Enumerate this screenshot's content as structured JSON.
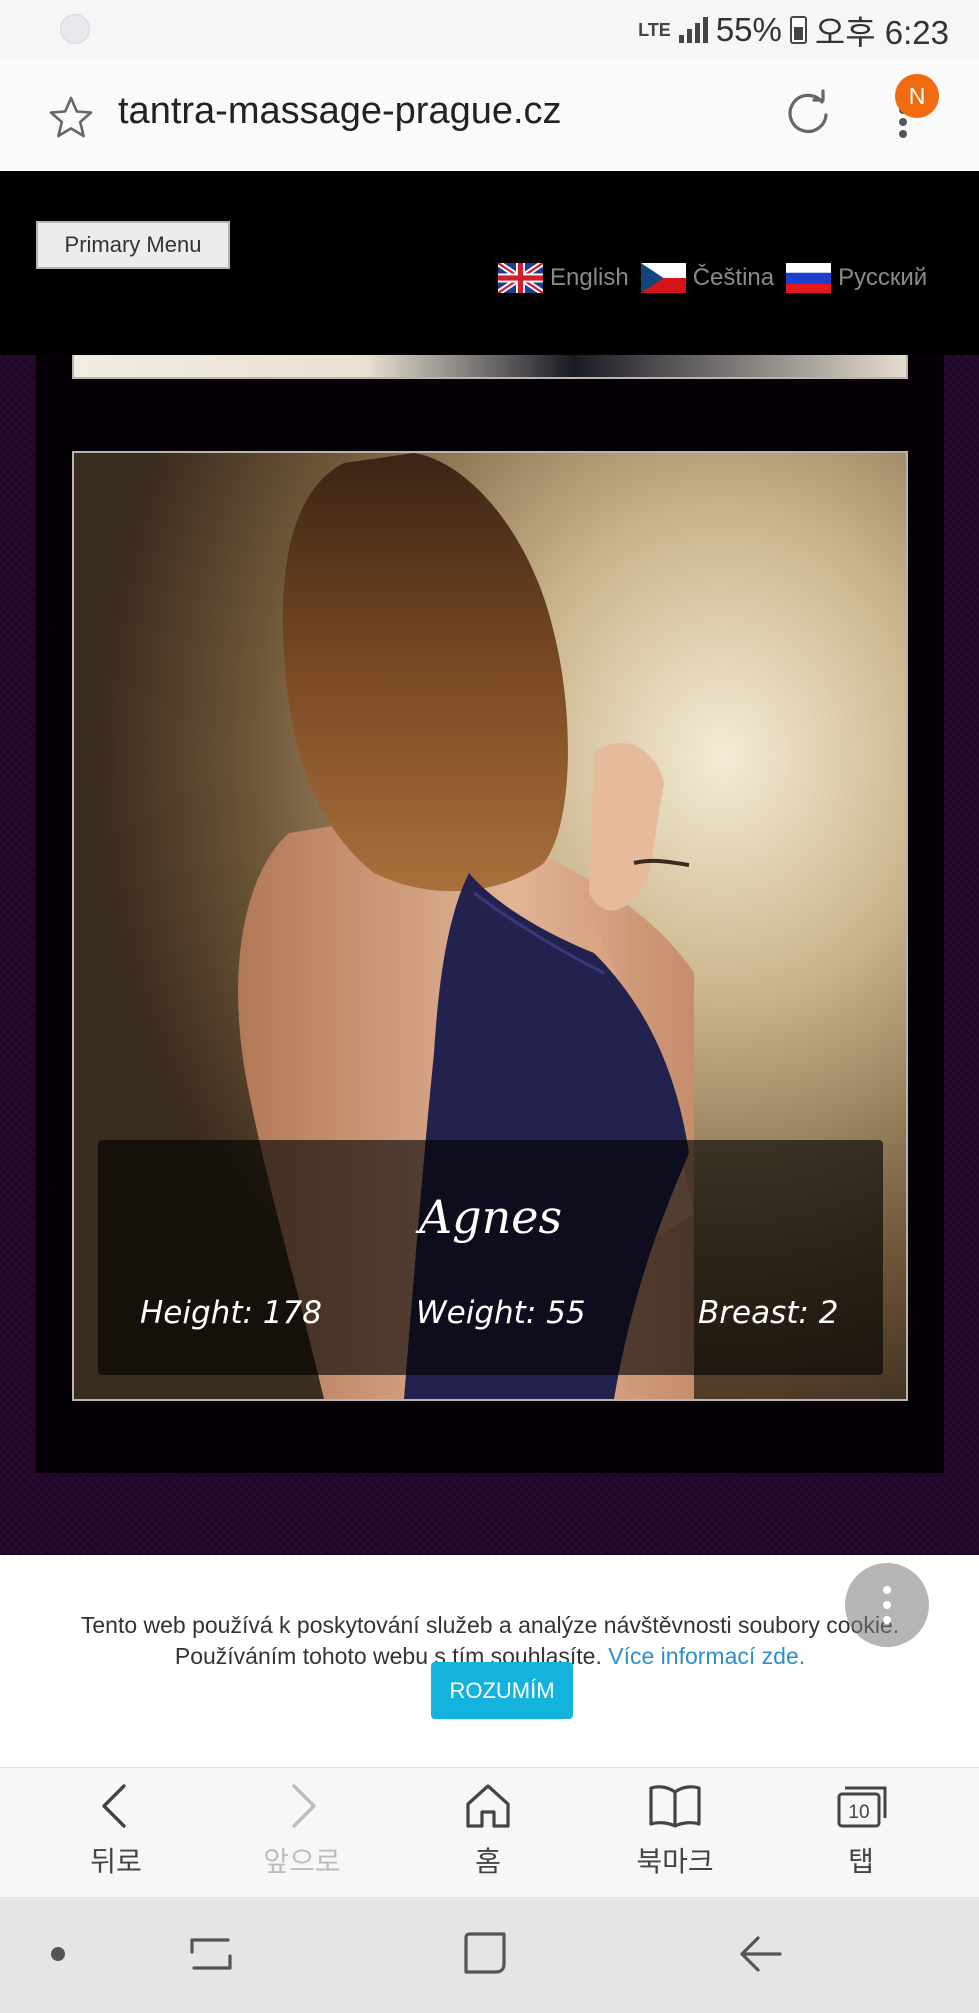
{
  "status_bar": {
    "network": "LTE",
    "battery": "55%",
    "time": "오후 6:23"
  },
  "browser": {
    "url": "tantra-massage-prague.cz",
    "notification_badge": "N",
    "bottom_nav": [
      {
        "label": "뒤로",
        "icon": "back-arrow-icon",
        "enabled": true
      },
      {
        "label": "앞으로",
        "icon": "forward-arrow-icon",
        "enabled": false
      },
      {
        "label": "홈",
        "icon": "home-icon",
        "enabled": true
      },
      {
        "label": "북마크",
        "icon": "bookmark-book-icon",
        "enabled": true
      },
      {
        "label": "탭",
        "icon": "tabs-icon",
        "enabled": true,
        "count": "10"
      }
    ]
  },
  "site": {
    "primary_menu_label": "Primary Menu",
    "languages": [
      {
        "label": "English",
        "flag": "uk-flag-icon"
      },
      {
        "label": "Čeština",
        "flag": "czech-flag-icon"
      },
      {
        "label": "Русский",
        "flag": "russian-flag-icon"
      }
    ],
    "profile": {
      "name": "Agnes",
      "height_label": "Height:",
      "height_value": "178",
      "weight_label": "Weight:",
      "weight_value": "55",
      "breast_label": "Breast:",
      "breast_value": "2"
    }
  },
  "cookie_bar": {
    "text": "Tento web používá k poskytování služeb a analýze návštěvnosti soubory cookie. Používáním tohoto webu s tím souhlasíte.",
    "link": "Více informací zde.",
    "accept_label": "ROZUMÍM"
  },
  "colors": {
    "accent_button": "#14b3de",
    "link": "#2e8ec7",
    "notification": "#f06a12",
    "site_background": "#22082b"
  }
}
